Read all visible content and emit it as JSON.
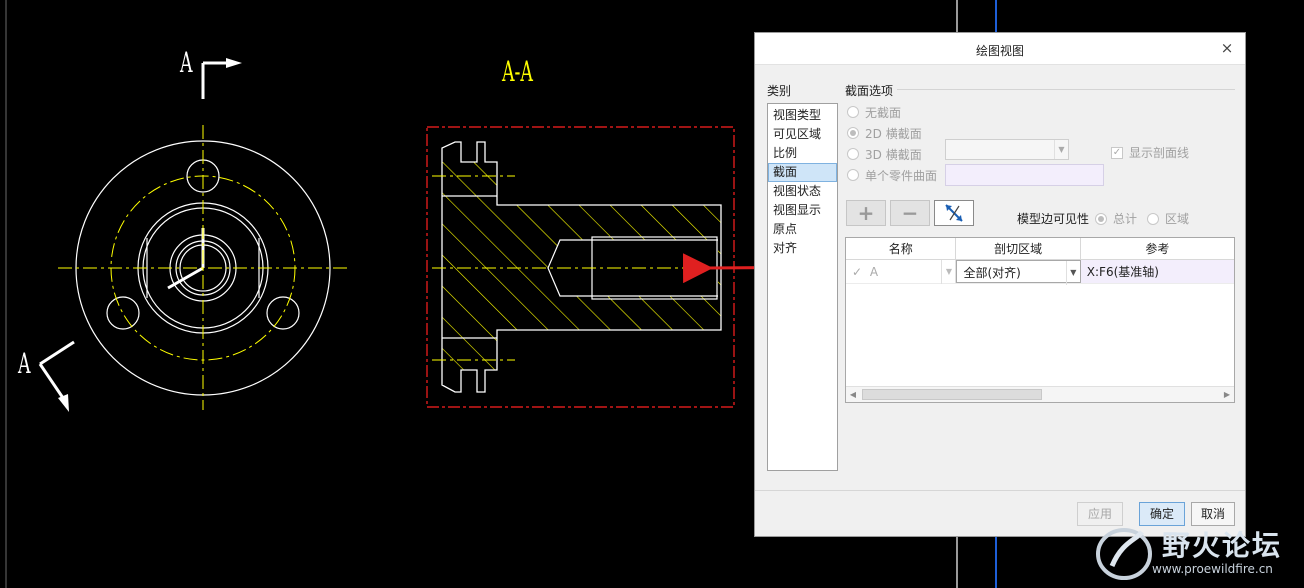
{
  "drawing": {
    "front_view_label": "A",
    "section_arrow_label": "A",
    "section_view_label": "A-A"
  },
  "dialog": {
    "title": "绘图视图",
    "close_glyph": "×",
    "category_label": "类别",
    "categories": [
      "视图类型",
      "可见区域",
      "比例",
      "截面",
      "视图状态",
      "视图显示",
      "原点",
      "对齐"
    ],
    "selected_category": "截面",
    "section_options": {
      "header": "截面选项",
      "options": [
        "无截面",
        "2D 横截面",
        "3D 横截面",
        "单个零件曲面"
      ],
      "selected": "2D 横截面",
      "show_hatch_label": "显示剖面线",
      "show_hatch_checked": true
    },
    "toolbar": {
      "add_glyph": "+",
      "remove_glyph": "−",
      "flip_icon": "flip-arrows-icon"
    },
    "model_edge_visibility": {
      "label": "模型边可见性",
      "options": [
        "总计",
        "区域"
      ],
      "selected": "总计"
    },
    "table": {
      "columns": [
        "名称",
        "剖切区域",
        "参考"
      ],
      "rows": [
        {
          "status_glyph": "✓",
          "name": "A",
          "region": "全部(对齐)",
          "reference": "X:F6(基准轴)"
        }
      ]
    },
    "buttons": {
      "apply": "应用",
      "ok": "确定",
      "cancel": "取消"
    }
  },
  "watermark": {
    "title": "野火论坛",
    "url": "www.proewildfire.cn"
  },
  "colors": {
    "canvas": "#000000",
    "geometry": "#ffffff",
    "centerline": "#ffff00",
    "hatch": "#ffff00",
    "section_frame": "#ff0000",
    "annotation_arrow": "#e02020",
    "axis_line": "#1e5fd8"
  }
}
